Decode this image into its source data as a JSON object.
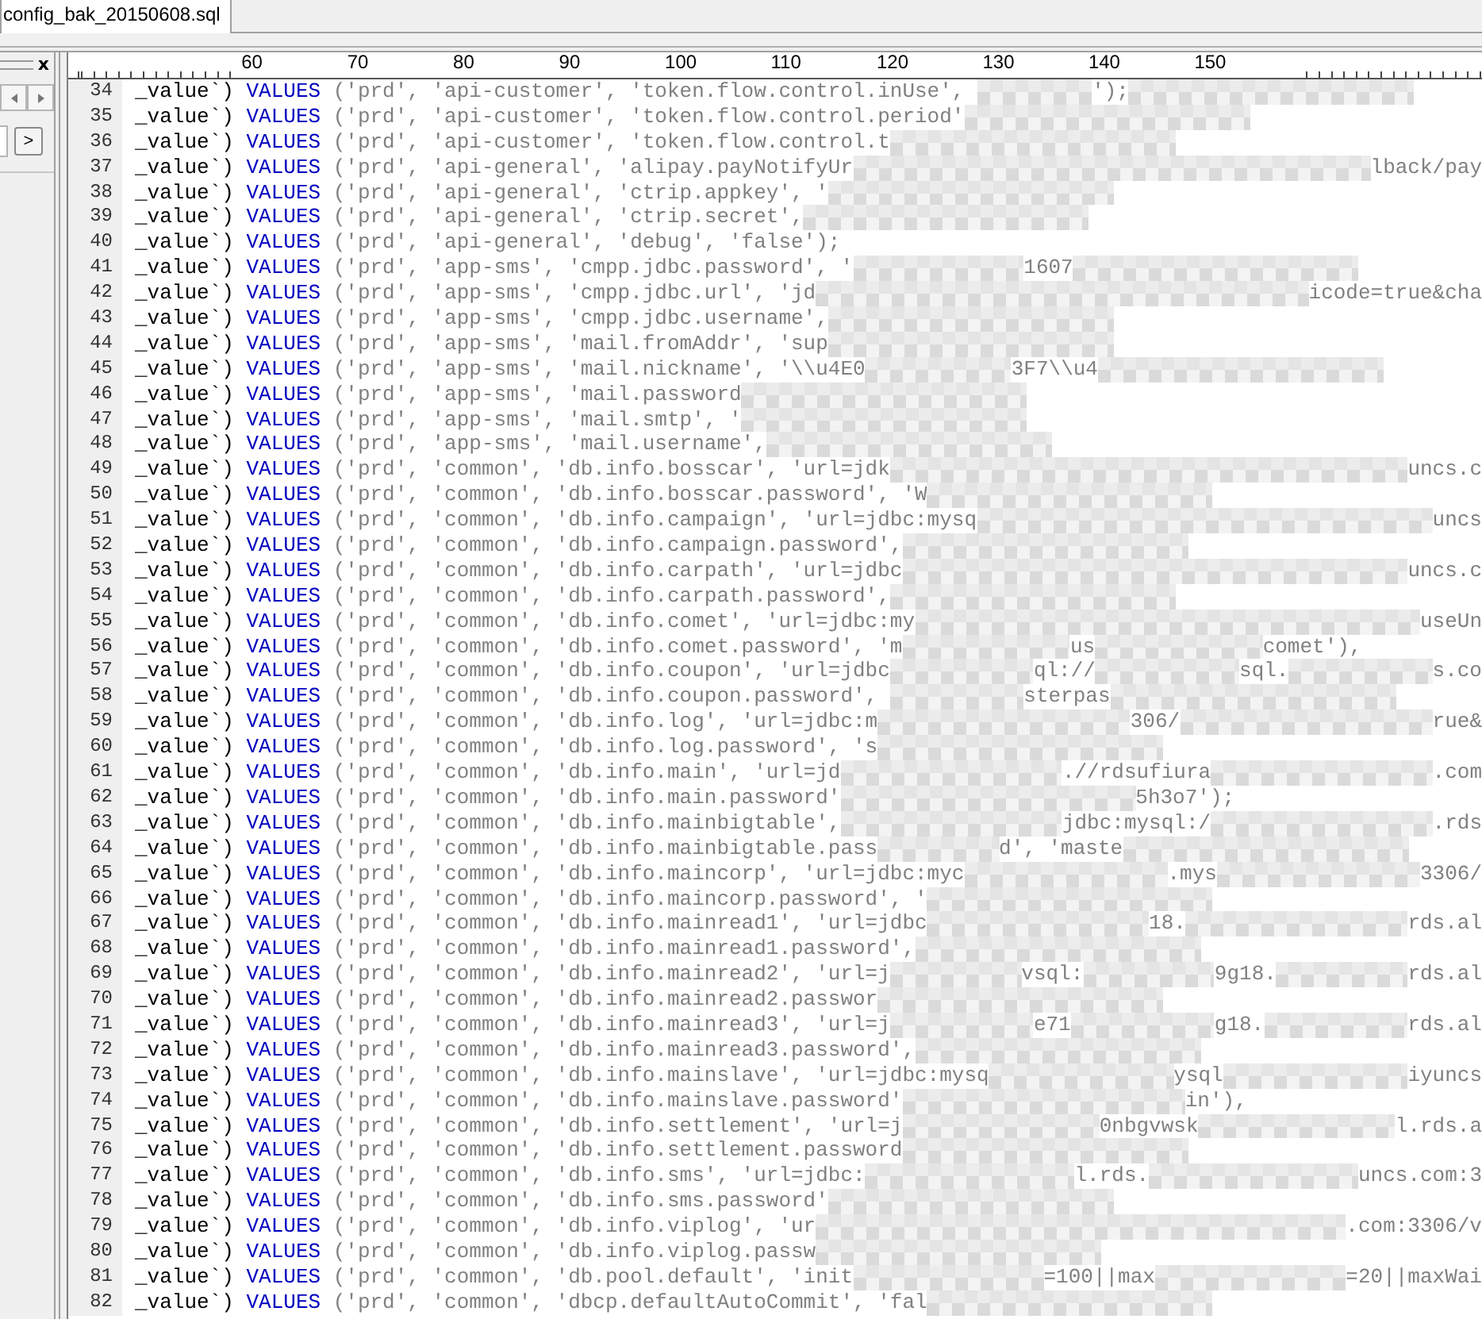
{
  "tab": {
    "label": "config_bak_20150608.sql",
    "selected": true
  },
  "side_panel": {
    "close": "x",
    "next": ">"
  },
  "ruler": {
    "labels": [
      "60",
      "70",
      "80",
      "90",
      "100",
      "110",
      "120",
      "130",
      "140",
      "150"
    ]
  },
  "lines": [
    {
      "number": "34",
      "prefix": "_value`)",
      "keyword": "VALUES",
      "segments": [
        "('prd', 'api-customer', 'token.flow.control.inUse', ",
        "');"
      ],
      "redacted_after": true,
      "runs_to_edge": false
    },
    {
      "number": "35",
      "prefix": "_value`)",
      "keyword": "VALUES",
      "segments": [
        "('prd', 'api-customer', 'token.flow.control.period'"
      ],
      "redacted_after": true,
      "runs_to_edge": false
    },
    {
      "number": "36",
      "prefix": "_value`)",
      "keyword": "VALUES",
      "segments": [
        "('prd', 'api-customer', 'token.flow.control.t"
      ],
      "redacted_after": true,
      "runs_to_edge": false
    },
    {
      "number": "37",
      "prefix": "_value`)",
      "keyword": "VALUES",
      "segments": [
        "('prd', 'api-general', 'alipay.payNotifyUr",
        "lback/pay"
      ],
      "redacted_after": false,
      "runs_to_edge": true
    },
    {
      "number": "38",
      "prefix": "_value`)",
      "keyword": "VALUES",
      "segments": [
        "('prd', 'api-general', 'ctrip.appkey', '"
      ],
      "redacted_after": true,
      "runs_to_edge": false
    },
    {
      "number": "39",
      "prefix": "_value`)",
      "keyword": "VALUES",
      "segments": [
        "('prd', 'api-general', 'ctrip.secret',"
      ],
      "redacted_after": true,
      "runs_to_edge": false
    },
    {
      "number": "40",
      "prefix": "_value`)",
      "keyword": "VALUES",
      "segments": [
        "('prd', 'api-general', 'debug', 'false');"
      ],
      "redacted_after": false,
      "runs_to_edge": false
    },
    {
      "number": "41",
      "prefix": "_value`)",
      "keyword": "VALUES",
      "segments": [
        "('prd', 'app-sms', 'cmpp.jdbc.password', '",
        "1607"
      ],
      "redacted_after": true,
      "runs_to_edge": false
    },
    {
      "number": "42",
      "prefix": "_value`)",
      "keyword": "VALUES",
      "segments": [
        "('prd', 'app-sms', 'cmpp.jdbc.url', 'jd",
        "icode=true&cha"
      ],
      "redacted_after": false,
      "runs_to_edge": true
    },
    {
      "number": "43",
      "prefix": "_value`)",
      "keyword": "VALUES",
      "segments": [
        "('prd', 'app-sms', 'cmpp.jdbc.username',"
      ],
      "redacted_after": true,
      "runs_to_edge": false
    },
    {
      "number": "44",
      "prefix": "_value`)",
      "keyword": "VALUES",
      "segments": [
        "('prd', 'app-sms', 'mail.fromAddr', 'sup"
      ],
      "redacted_after": true,
      "runs_to_edge": false
    },
    {
      "number": "45",
      "prefix": "_value`)",
      "keyword": "VALUES",
      "segments": [
        "('prd', 'app-sms', 'mail.nickname', '\\\\u4E0",
        "3F7\\\\u4"
      ],
      "redacted_after": true,
      "runs_to_edge": false
    },
    {
      "number": "46",
      "prefix": "_value`)",
      "keyword": "VALUES",
      "segments": [
        "('prd', 'app-sms', 'mail.password"
      ],
      "redacted_after": true,
      "runs_to_edge": false
    },
    {
      "number": "47",
      "prefix": "_value`)",
      "keyword": "VALUES",
      "segments": [
        "('prd', 'app-sms', 'mail.smtp', '"
      ],
      "redacted_after": true,
      "runs_to_edge": false
    },
    {
      "number": "48",
      "prefix": "_value`)",
      "keyword": "VALUES",
      "segments": [
        "('prd', 'app-sms', 'mail.username',"
      ],
      "redacted_after": true,
      "runs_to_edge": false
    },
    {
      "number": "49",
      "prefix": "_value`)",
      "keyword": "VALUES",
      "segments": [
        "('prd', 'common', 'db.info.bosscar', 'url=jdk",
        "uncs.c"
      ],
      "redacted_after": false,
      "runs_to_edge": true
    },
    {
      "number": "50",
      "prefix": "_value`)",
      "keyword": "VALUES",
      "segments": [
        "('prd', 'common', 'db.info.bosscar.password', 'W"
      ],
      "redacted_after": true,
      "runs_to_edge": false
    },
    {
      "number": "51",
      "prefix": "_value`)",
      "keyword": "VALUES",
      "segments": [
        "('prd', 'common', 'db.info.campaign', 'url=jdbc:mysq",
        "uncs"
      ],
      "redacted_after": false,
      "runs_to_edge": true
    },
    {
      "number": "52",
      "prefix": "_value`)",
      "keyword": "VALUES",
      "segments": [
        "('prd', 'common', 'db.info.campaign.password',"
      ],
      "redacted_after": true,
      "runs_to_edge": false
    },
    {
      "number": "53",
      "prefix": "_value`)",
      "keyword": "VALUES",
      "segments": [
        "('prd', 'common', 'db.info.carpath', 'url=jdbc",
        "uncs.c"
      ],
      "redacted_after": false,
      "runs_to_edge": true
    },
    {
      "number": "54",
      "prefix": "_value`)",
      "keyword": "VALUES",
      "segments": [
        "('prd', 'common', 'db.info.carpath.password',"
      ],
      "redacted_after": true,
      "runs_to_edge": false
    },
    {
      "number": "55",
      "prefix": "_value`)",
      "keyword": "VALUES",
      "segments": [
        "('prd', 'common', 'db.info.comet', 'url=jdbc:my",
        "useUn"
      ],
      "redacted_after": false,
      "runs_to_edge": true
    },
    {
      "number": "56",
      "prefix": "_value`)",
      "keyword": "VALUES",
      "segments": [
        "('prd', 'common', 'db.info.comet.password', 'm",
        "us",
        "comet'),"
      ],
      "redacted_after": false,
      "runs_to_edge": false
    },
    {
      "number": "57",
      "prefix": "_value`)",
      "keyword": "VALUES",
      "segments": [
        "('prd', 'common', 'db.info.coupon', 'url=jdbc",
        "ql://",
        "sql.",
        "s.co"
      ],
      "redacted_after": false,
      "runs_to_edge": true
    },
    {
      "number": "58",
      "prefix": "_value`)",
      "keyword": "VALUES",
      "segments": [
        "('prd', 'common', 'db.info.coupon.password', ",
        "sterpas"
      ],
      "redacted_after": true,
      "runs_to_edge": false
    },
    {
      "number": "59",
      "prefix": "_value`)",
      "keyword": "VALUES",
      "segments": [
        "('prd', 'common', 'db.info.log', 'url=jdbc:m",
        "306/",
        "rue&"
      ],
      "redacted_after": false,
      "runs_to_edge": true
    },
    {
      "number": "60",
      "prefix": "_value`)",
      "keyword": "VALUES",
      "segments": [
        "('prd', 'common', 'db.info.log.password', 's"
      ],
      "redacted_after": true,
      "runs_to_edge": false
    },
    {
      "number": "61",
      "prefix": "_value`)",
      "keyword": "VALUES",
      "segments": [
        "('prd', 'common', 'db.info.main', 'url=jd",
        ".//rdsufiura",
        ".com"
      ],
      "redacted_after": false,
      "runs_to_edge": true
    },
    {
      "number": "62",
      "prefix": "_value`)",
      "keyword": "VALUES",
      "segments": [
        "('prd', 'common', 'db.info.main.password'",
        "5h3o7');"
      ],
      "redacted_after": false,
      "runs_to_edge": false
    },
    {
      "number": "63",
      "prefix": "_value`)",
      "keyword": "VALUES",
      "segments": [
        "('prd', 'common', 'db.info.mainbigtable',",
        "jdbc:mysql:/",
        ".rds"
      ],
      "redacted_after": false,
      "runs_to_edge": true
    },
    {
      "number": "64",
      "prefix": "_value`)",
      "keyword": "VALUES",
      "segments": [
        "('prd', 'common', 'db.info.mainbigtable.pass",
        "d', 'maste"
      ],
      "redacted_after": true,
      "runs_to_edge": false
    },
    {
      "number": "65",
      "prefix": "_value`)",
      "keyword": "VALUES",
      "segments": [
        "('prd', 'common', 'db.info.maincorp', 'url=jdbc:myc",
        ".mys",
        "3306/"
      ],
      "redacted_after": false,
      "runs_to_edge": true
    },
    {
      "number": "66",
      "prefix": "_value`)",
      "keyword": "VALUES",
      "segments": [
        "('prd', 'common', 'db.info.maincorp.password', '"
      ],
      "redacted_after": true,
      "runs_to_edge": false
    },
    {
      "number": "67",
      "prefix": "_value`)",
      "keyword": "VALUES",
      "segments": [
        "('prd', 'common', 'db.info.mainread1', 'url=jdbc",
        "18.",
        "rds.al"
      ],
      "redacted_after": false,
      "runs_to_edge": true
    },
    {
      "number": "68",
      "prefix": "_value`)",
      "keyword": "VALUES",
      "segments": [
        "('prd', 'common', 'db.info.mainread1.password',"
      ],
      "redacted_after": true,
      "runs_to_edge": false
    },
    {
      "number": "69",
      "prefix": "_value`)",
      "keyword": "VALUES",
      "segments": [
        "('prd', 'common', 'db.info.mainread2', 'url=j",
        "vsql:",
        "9g18.",
        "rds.al"
      ],
      "redacted_after": false,
      "runs_to_edge": true
    },
    {
      "number": "70",
      "prefix": "_value`)",
      "keyword": "VALUES",
      "segments": [
        "('prd', 'common', 'db.info.mainread2.passwor"
      ],
      "redacted_after": true,
      "runs_to_edge": false
    },
    {
      "number": "71",
      "prefix": "_value`)",
      "keyword": "VALUES",
      "segments": [
        "('prd', 'common', 'db.info.mainread3', 'url=j",
        "e71",
        "g18.",
        "rds.al"
      ],
      "redacted_after": false,
      "runs_to_edge": true
    },
    {
      "number": "72",
      "prefix": "_value`)",
      "keyword": "VALUES",
      "segments": [
        "('prd', 'common', 'db.info.mainread3.password',"
      ],
      "redacted_after": true,
      "runs_to_edge": false
    },
    {
      "number": "73",
      "prefix": "_value`)",
      "keyword": "VALUES",
      "segments": [
        "('prd', 'common', 'db.info.mainslave', 'url=jdbc:mysq",
        "ysql",
        "iyuncs"
      ],
      "redacted_after": false,
      "runs_to_edge": true
    },
    {
      "number": "74",
      "prefix": "_value`)",
      "keyword": "VALUES",
      "segments": [
        "('prd', 'common', 'db.info.mainslave.password'",
        "in'),"
      ],
      "redacted_after": false,
      "runs_to_edge": false
    },
    {
      "number": "75",
      "prefix": "_value`)",
      "keyword": "VALUES",
      "segments": [
        "('prd', 'common', 'db.info.settlement', 'url=j",
        "0nbgvwsk",
        "l.rds.a"
      ],
      "redacted_after": false,
      "runs_to_edge": true
    },
    {
      "number": "76",
      "prefix": "_value`)",
      "keyword": "VALUES",
      "segments": [
        "('prd', 'common', 'db.info.settlement.password"
      ],
      "redacted_after": true,
      "runs_to_edge": false
    },
    {
      "number": "77",
      "prefix": "_value`)",
      "keyword": "VALUES",
      "segments": [
        "('prd', 'common', 'db.info.sms', 'url=jdbc:",
        "l.rds.",
        "uncs.com:3"
      ],
      "redacted_after": false,
      "runs_to_edge": true
    },
    {
      "number": "78",
      "prefix": "_value`)",
      "keyword": "VALUES",
      "segments": [
        "('prd', 'common', 'db.info.sms.password'"
      ],
      "redacted_after": true,
      "runs_to_edge": false
    },
    {
      "number": "79",
      "prefix": "_value`)",
      "keyword": "VALUES",
      "segments": [
        "('prd', 'common', 'db.info.viplog', 'ur",
        ".com:3306/v"
      ],
      "redacted_after": false,
      "runs_to_edge": true
    },
    {
      "number": "80",
      "prefix": "_value`)",
      "keyword": "VALUES",
      "segments": [
        "('prd', 'common', 'db.info.viplog.passw"
      ],
      "redacted_after": true,
      "runs_to_edge": false
    },
    {
      "number": "81",
      "prefix": "_value`)",
      "keyword": "VALUES",
      "segments": [
        "('prd', 'common', 'db.pool.default', 'init",
        "=100||max",
        "=20||maxWai"
      ],
      "redacted_after": false,
      "runs_to_edge": true
    },
    {
      "number": "82",
      "prefix": "_value`)",
      "keyword": "VALUES",
      "segments": [
        "('prd', 'common', 'dbcp.defaultAutoCommit', 'fal"
      ],
      "redacted_after": true,
      "runs_to_edge": false
    }
  ]
}
